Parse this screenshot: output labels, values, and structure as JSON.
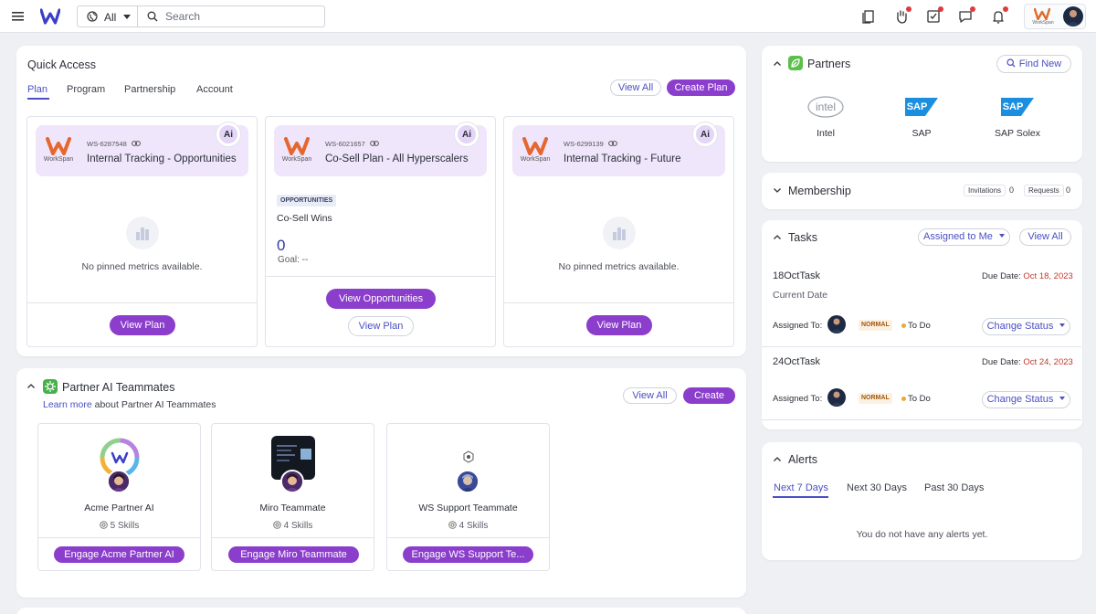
{
  "header": {
    "scope_label": "All",
    "search_placeholder": "Search",
    "workspace_logo_text": "WorkSpan"
  },
  "quick_access": {
    "title": "Quick Access",
    "tabs": [
      "Plan",
      "Program",
      "Partnership",
      "Account"
    ],
    "active_tab": "Plan",
    "view_all": "View All",
    "create_plan": "Create Plan",
    "plans": [
      {
        "logo_text": "WorkSpan",
        "id": "WS-6287548",
        "name": "Internal Tracking - Opportunities",
        "empty_text": "No pinned metrics available.",
        "view_plan": "View Plan"
      },
      {
        "logo_text": "WorkSpan",
        "id": "WS-6021657",
        "name": "Co-Sell Plan - All Hyperscalers",
        "metric_badge": "OPPORTUNITIES",
        "metric_title": "Co-Sell Wins",
        "metric_value": "0",
        "metric_goal": "Goal: --",
        "view_opportunities": "View Opportunities",
        "view_plan": "View Plan"
      },
      {
        "logo_text": "WorkSpan",
        "id": "WS-6299139",
        "name": "Internal Tracking - Future",
        "empty_text": "No pinned metrics available.",
        "view_plan": "View Plan"
      }
    ],
    "ai_badge_text": "Ai"
  },
  "partner_ai": {
    "title": "Partner AI Teammates",
    "learn_more": "Learn more",
    "subtitle_rest": " about Partner AI Teammates",
    "view_all": "View All",
    "create": "Create",
    "teammates": [
      {
        "name": "Acme Partner AI",
        "skills": "5 Skills",
        "engage": "Engage Acme Partner AI"
      },
      {
        "name": "Miro Teammate",
        "skills": "4 Skills",
        "engage": "Engage Miro Teammate"
      },
      {
        "name": "WS Support Teammate",
        "skills": "4 Skills",
        "engage": "Engage WS Support Te..."
      }
    ]
  },
  "partners": {
    "title": "Partners",
    "find_new": "Find New",
    "items": [
      {
        "name": "Intel",
        "logo_text": "intel"
      },
      {
        "name": "SAP",
        "logo_text": "SAP"
      },
      {
        "name": "SAP Solex",
        "logo_text": "SAP"
      }
    ]
  },
  "membership": {
    "title": "Membership",
    "invitations_label": "Invitations",
    "invitations_count": "0",
    "requests_label": "Requests",
    "requests_count": "0"
  },
  "tasks": {
    "title": "Tasks",
    "filter": "Assigned to Me",
    "view_all": "View All",
    "due_label": "Due Date: ",
    "assigned_label": "Assigned To:",
    "change_status": "Change Status",
    "items": [
      {
        "title": "18OctTask",
        "description": "Current Date",
        "due": "Oct 18, 2023",
        "priority": "NORMAL",
        "status": "To Do"
      },
      {
        "title": "24OctTask",
        "description": "",
        "due": "Oct 24, 2023",
        "priority": "NORMAL",
        "status": "To Do"
      }
    ]
  },
  "alerts": {
    "title": "Alerts",
    "tabs": [
      "Next 7 Days",
      "Next 30 Days",
      "Past 30 Days"
    ],
    "active_tab": "Next 7 Days",
    "empty_text": "You do not have any alerts yet."
  },
  "colors": {
    "accent": "#4a4fc4",
    "button": "#8b3dcc",
    "plan_header": "#efe6fb",
    "due_date": "#c0392b",
    "notification_dot": "#e03a3a"
  },
  "icons": [
    "menu-icon",
    "globe-icon",
    "chevron-down-icon",
    "search-icon",
    "bookmark-icon",
    "hand-icon",
    "checkbox-icon",
    "chat-icon",
    "bell-icon",
    "link-icon",
    "chart-icon",
    "skills-icon",
    "leaf-icon",
    "robot-icon",
    "chevron-up-icon"
  ]
}
